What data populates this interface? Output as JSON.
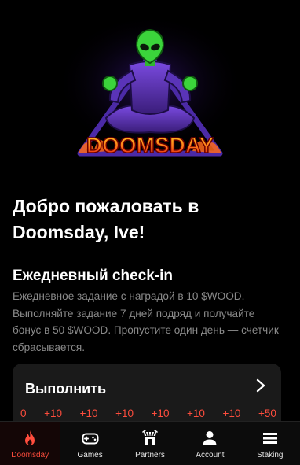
{
  "logo": {
    "brand_text": "DOOMSDAY"
  },
  "welcome": {
    "title": "Добро пожаловать в Doomsday, Ive!"
  },
  "checkin": {
    "title": "Ежедневный check-in",
    "description": "Ежедневное задание с наградой в 10 $WOOD. Выполняйте задание 7 дней подряд и получайте бонус в 50 $WOOD. Пропустите один день — счетчик сбрасывается."
  },
  "task_card": {
    "title": "Выполнить",
    "rewards": [
      "0",
      "+10",
      "+10",
      "+10",
      "+10",
      "+10",
      "+10",
      "+50"
    ]
  },
  "tabbar": {
    "active": "Doomsday",
    "items": [
      {
        "label": "Doomsday",
        "icon": "flame-icon"
      },
      {
        "label": "Games",
        "icon": "gamepad-icon"
      },
      {
        "label": "Partners",
        "icon": "ticket-booth-icon"
      },
      {
        "label": "Account",
        "icon": "user-icon"
      },
      {
        "label": "Staking",
        "icon": "menu-stack-icon"
      }
    ]
  },
  "colors": {
    "background": "#000000",
    "accent": "#ff4d3d",
    "card": "#1a1a1a",
    "muted_text": "#8a8a8a",
    "alien_green": "#3bd43b",
    "figure_purple": "#6b3fc2"
  }
}
